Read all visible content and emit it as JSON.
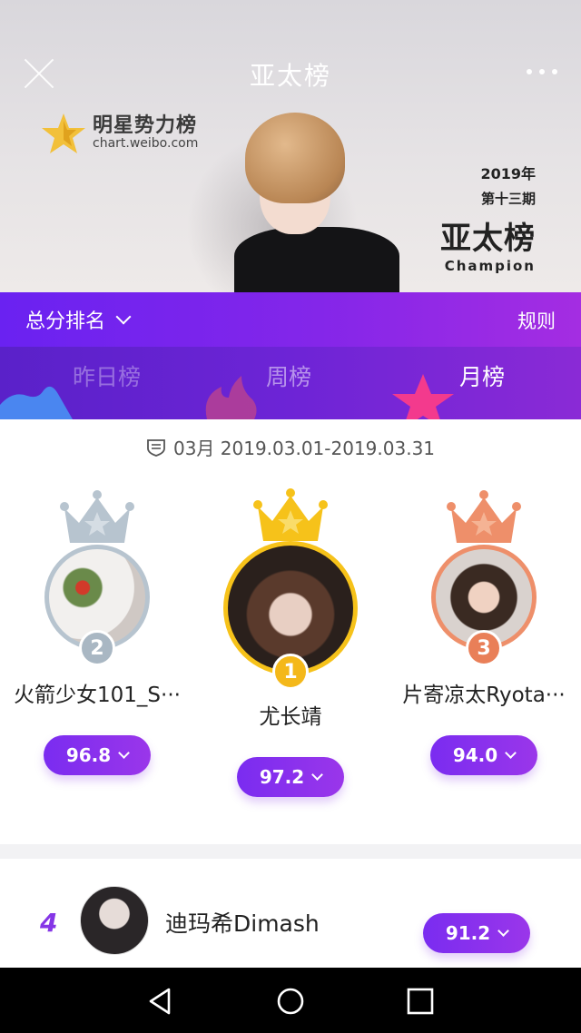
{
  "header": {
    "title": "亚太榜",
    "close_icon": "close-icon",
    "more_icon": "more-dots-icon"
  },
  "banner": {
    "logo_name": "明星势力榜",
    "logo_url": "chart.weibo.com",
    "year": "2019年",
    "issue": "第十三期",
    "title": "亚太榜",
    "subtitle": "Champion"
  },
  "rank_bar": {
    "select_label": "总分排名",
    "rules_label": "规则"
  },
  "tabs": [
    {
      "label": "昨日榜",
      "active": false
    },
    {
      "label": "周榜",
      "active": false
    },
    {
      "label": "月榜",
      "active": true
    }
  ],
  "period": {
    "text": "03月 2019.03.01-2019.03.31"
  },
  "podium": [
    {
      "rank": "2",
      "name": "火箭少女101_S···",
      "score": "96.8",
      "color": "#b7c4cf"
    },
    {
      "rank": "1",
      "name": "尤长靖",
      "score": "97.2",
      "color": "#f6c21a"
    },
    {
      "rank": "3",
      "name": "片寄凉太Ryota···",
      "score": "94.0",
      "color": "#ee8f6a"
    }
  ],
  "list": [
    {
      "rank": "4",
      "name": "迪玛希Dimash",
      "score": "91.2"
    }
  ],
  "colors": {
    "accent": "#7a2cf0",
    "accent_light": "#a42de2",
    "gold": "#f6c21a",
    "silver": "#b7c4cf",
    "bronze": "#ee8f6a"
  },
  "system_nav": [
    "back-icon",
    "home-icon",
    "recents-icon"
  ]
}
